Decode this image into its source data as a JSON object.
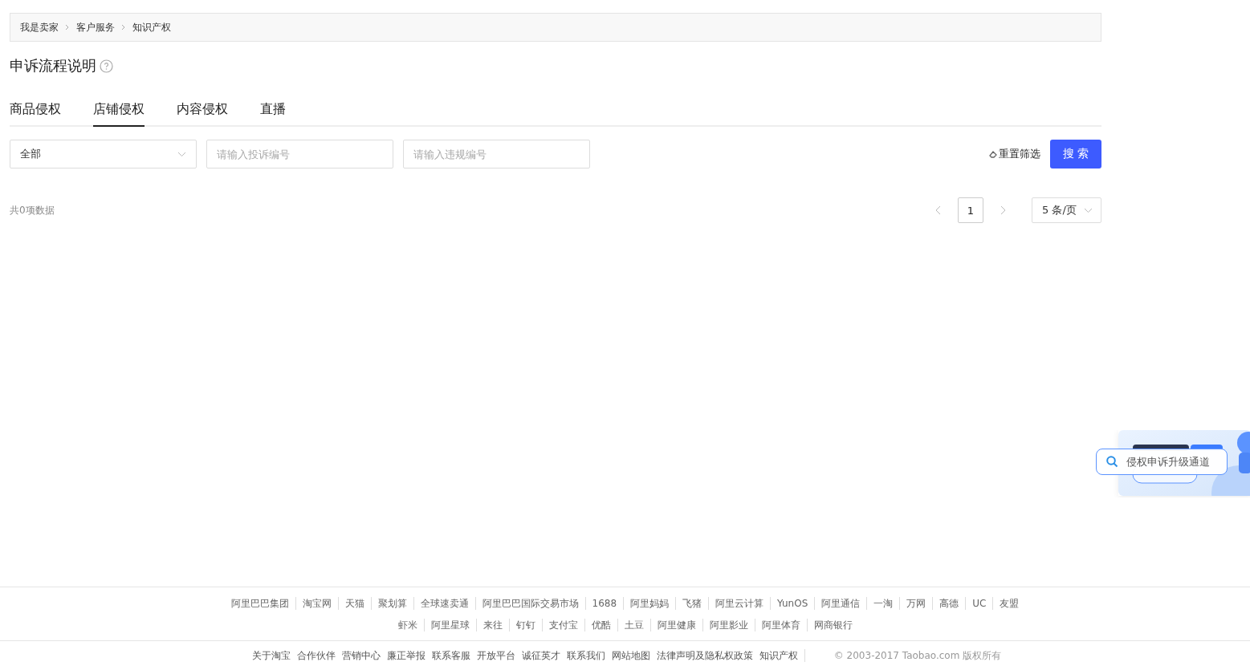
{
  "breadcrumb": [
    "我是卖家",
    "客户服务",
    "知识产权"
  ],
  "title": "申诉流程说明",
  "tabs": [
    {
      "label": "商品侵权",
      "selected": false
    },
    {
      "label": "店铺侵权",
      "selected": true
    },
    {
      "label": "内容侵权",
      "selected": false
    },
    {
      "label": "直播",
      "selected": false
    }
  ],
  "filters": {
    "select": {
      "value": "全部"
    },
    "complaint_no": {
      "placeholder": "请输入投诉编号"
    },
    "violation_no": {
      "placeholder": "请输入违规编号"
    },
    "reset": "重置筛选",
    "search": "搜 索"
  },
  "total": "共0项数据",
  "pagination": {
    "pages": [
      {
        "label": "1",
        "selected": true
      }
    ],
    "page_size": "5 条/页"
  },
  "float_widget": {
    "kind": "picture",
    "pill": "侵权申诉升级通道"
  },
  "footer": {
    "links_row_1": [
      "阿里巴巴集团",
      "淘宝网",
      "天猫",
      "聚划算",
      "全球速卖通",
      "阿里巴巴国际交易市场",
      "1688",
      "阿里妈妈",
      "飞猪",
      "阿里云计算",
      "YunOS",
      "阿里通信",
      "一淘",
      "万网",
      "高德",
      "UC",
      "友盟"
    ],
    "links_row_2": [
      "虾米",
      "阿里星球",
      "来往",
      "钉钉",
      "支付宝",
      "优酷",
      "土豆",
      "阿里健康",
      "阿里影业",
      "阿里体育",
      "网商银行"
    ],
    "bottom_links": [
      "关于淘宝",
      "合作伙伴",
      "营销中心",
      "廉正举报",
      "联系客服",
      "开放平台",
      "诚征英才",
      "联系我们",
      "网站地图",
      "法律声明及隐私权政策",
      "知识产权"
    ],
    "copyright": "© 2003-2017 Taobao.com 版权所有"
  }
}
